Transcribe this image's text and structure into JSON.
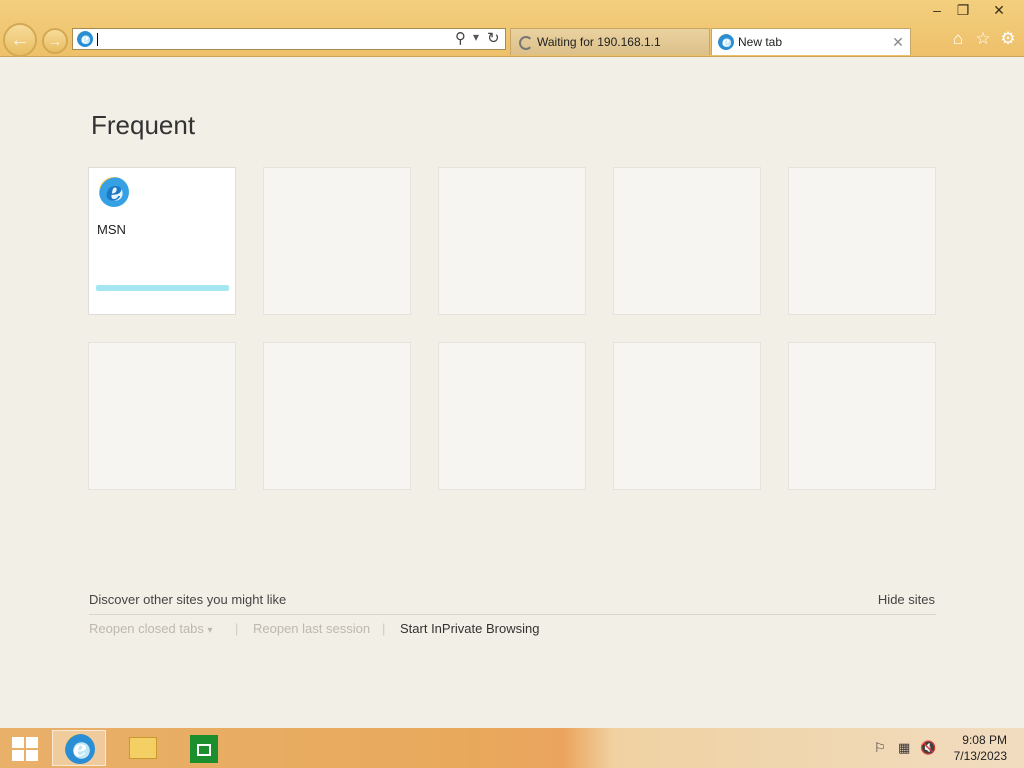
{
  "window": {
    "minimize": "–",
    "restore": "❐",
    "close": "✕"
  },
  "nav": {
    "back_glyph": "←",
    "forward_glyph": "→"
  },
  "address_bar": {
    "value": "",
    "search_glyph": "⚲",
    "dropdown_glyph": "▾",
    "refresh_glyph": "↻"
  },
  "tabs": [
    {
      "label": "Waiting for 190.168.1.1",
      "state": "loading"
    },
    {
      "label": "New tab",
      "state": "active",
      "close_glyph": "✕"
    }
  ],
  "toolbar_icons": {
    "home": "⌂",
    "favorites": "☆",
    "tools": "⚙"
  },
  "frequent": {
    "heading": "Frequent",
    "tiles": [
      {
        "name": "MSN",
        "icon": "ie-icon",
        "accent": "#a6e6f0"
      },
      {
        "name": ""
      },
      {
        "name": ""
      },
      {
        "name": ""
      },
      {
        "name": ""
      },
      {
        "name": ""
      },
      {
        "name": ""
      },
      {
        "name": ""
      },
      {
        "name": ""
      },
      {
        "name": ""
      }
    ]
  },
  "footer": {
    "discover": "Discover other sites you might like",
    "hide_sites": "Hide sites",
    "reopen_closed_tabs": "Reopen closed tabs",
    "reopen_caret": "▾",
    "sep": "|",
    "reopen_last_session": "Reopen last session",
    "inprivate": "Start InPrivate Browsing"
  },
  "taskbar": {
    "apps": [
      "internet-explorer",
      "file-explorer",
      "store"
    ],
    "tray": {
      "flag": "⚐",
      "network": "▦",
      "volume": "🔇"
    },
    "time": "9:08 PM",
    "date": "7/13/2023"
  },
  "colors": {
    "background": "#f2efe6",
    "titlebar": "#eec06a",
    "store_green": "#1b8f2e"
  }
}
